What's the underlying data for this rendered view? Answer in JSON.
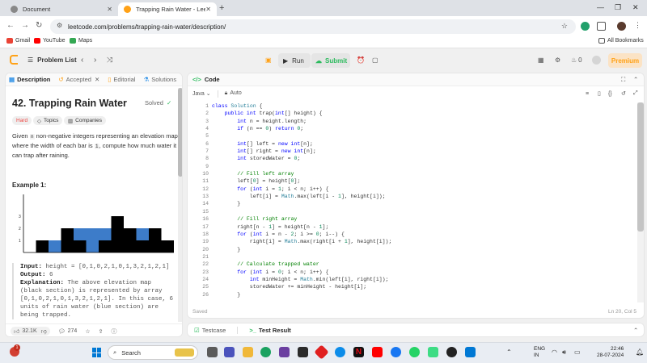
{
  "browser": {
    "tabs": [
      {
        "title": "Document"
      },
      {
        "title": "Trapping Rain Water - LeetCod"
      }
    ],
    "url": "leetcode.com/problems/trapping-rain-water/description/",
    "bookmarks": [
      "Gmail",
      "YouTube",
      "Maps"
    ],
    "all_bookmarks": "All Bookmarks"
  },
  "lc_header": {
    "problem_list": "Problem List",
    "run": "Run",
    "submit": "Submit",
    "streak": "0",
    "premium": "Premium"
  },
  "left": {
    "tabs": [
      "Description",
      "Accepted",
      "Editorial",
      "Solutions"
    ],
    "title": "42. Trapping Rain Water",
    "solved": "Solved",
    "chips": [
      "Hard",
      "Topics",
      "Companies"
    ],
    "desc_parts": [
      "Given ",
      "n",
      " non-negative integers representing an elevation map where the width of each bar is ",
      "1",
      ", compute how much water it can trap after raining."
    ],
    "example_label": "Example 1:",
    "example": {
      "input_label": "Input:",
      "input": " height = [0,1,0,2,1,0,1,3,2,1,2,1]",
      "output_label": "Output:",
      "output": " 6",
      "expl_label": "Explanation:",
      "expl": " The above elevation map (black section) is represented by array [0,1,0,2,1,0,1,3,2,1,2,1]. In this case, 6 units of rain water (blue section) are being trapped."
    },
    "footer": {
      "likes": "32.1K",
      "comments": "274"
    }
  },
  "elevation": {
    "heights": [
      0,
      1,
      0,
      2,
      1,
      0,
      1,
      3,
      2,
      1,
      2,
      1
    ],
    "water": [
      0,
      0,
      1,
      0,
      1,
      2,
      1,
      0,
      0,
      1,
      0,
      0
    ],
    "ticks": [
      "3",
      "2",
      "1"
    ],
    "bar_color": "#000000",
    "water_color": "#3d7cc9"
  },
  "right": {
    "tab": "Code",
    "lang": "Java",
    "mode": "Auto",
    "lines": [
      "class Solution {",
      "    public int trap(int[] height) {",
      "        int n = height.length;",
      "        if (n == 0) return 0;",
      "",
      "        int[] left = new int[n];",
      "        int[] right = new int[n];",
      "        int storedWater = 0;",
      "",
      "        // Fill left array",
      "        left[0] = height[0];",
      "        for (int i = 1; i < n; i++) {",
      "            left[i] = Math.max(left[i - 1], height[i]);",
      "        }",
      "",
      "        // Fill right array",
      "        right[n - 1] = height[n - 1];",
      "        for (int i = n - 2; i >= 0; i--) {",
      "            right[i] = Math.max(right[i + 1], height[i]);",
      "        }",
      "",
      "        // Calculate trapped water",
      "        for (int i = 0; i < n; i++) {",
      "            int minHeight = Math.min(left[i], right[i]);",
      "            storedWater += minHeight - height[i];",
      "        }"
    ],
    "status": "Saved",
    "position": "Ln 20, Col 5"
  },
  "bottom": {
    "testcase": "Testcase",
    "test_result": "Test Result"
  },
  "taskbar": {
    "search": "Search",
    "lang1": "ENG",
    "lang2": "IN",
    "time": "22:46",
    "date": "28-07-2024",
    "notif": "1"
  }
}
